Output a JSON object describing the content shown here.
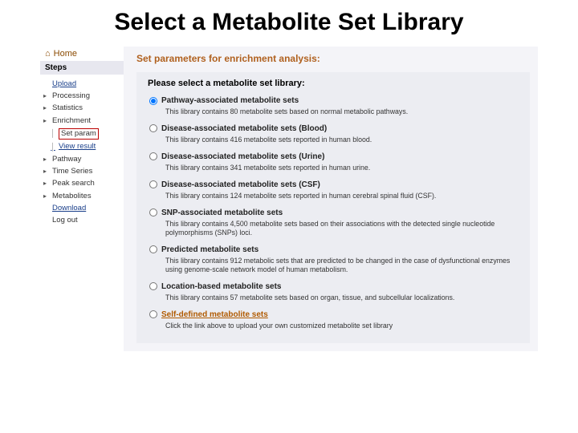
{
  "slide_title": "Select a Metabolite Set Library",
  "home": "Home",
  "steps_header": "Steps",
  "sidebar": {
    "items": [
      {
        "label": "Upload",
        "type": "link",
        "caret": false,
        "sub": false
      },
      {
        "label": "Processing",
        "type": "node",
        "caret": true,
        "sub": false
      },
      {
        "label": "Statistics",
        "type": "node",
        "caret": true,
        "sub": false
      },
      {
        "label": "Enrichment",
        "type": "node",
        "caret": true,
        "sub": false
      },
      {
        "label": "Set param",
        "type": "selected",
        "caret": false,
        "sub": true
      },
      {
        "label": "View result",
        "type": "link",
        "caret": false,
        "sub": true
      },
      {
        "label": "Pathway",
        "type": "node",
        "caret": true,
        "sub": false
      },
      {
        "label": "Time Series",
        "type": "node",
        "caret": true,
        "sub": false
      },
      {
        "label": "Peak search",
        "type": "node",
        "caret": true,
        "sub": false
      },
      {
        "label": "Metabolites",
        "type": "node",
        "caret": true,
        "sub": false
      },
      {
        "label": "Download",
        "type": "link",
        "caret": false,
        "sub": false
      },
      {
        "label": "Log out",
        "type": "text",
        "caret": false,
        "sub": false
      }
    ]
  },
  "main": {
    "header": "Set parameters for enrichment analysis:",
    "panel_title": "Please select a metabolite set library:",
    "options": [
      {
        "label": "Pathway-associated metabolite sets",
        "desc": "This library contains 80 metabolite sets based on normal metabolic pathways.",
        "checked": true,
        "link": false
      },
      {
        "label": "Disease-associated metabolite sets (Blood)",
        "desc": "This library contains 416 metabolite sets reported in human blood.",
        "checked": false,
        "link": false
      },
      {
        "label": "Disease-associated metabolite sets (Urine)",
        "desc": "This library contains 341 metabolite sets reported in human urine.",
        "checked": false,
        "link": false
      },
      {
        "label": "Disease-associated metabolite sets (CSF)",
        "desc": "This library contains 124 metabolite sets reported in human cerebral spinal fluid (CSF).",
        "checked": false,
        "link": false
      },
      {
        "label": "SNP-associated metabolite sets",
        "desc": "This library contains 4,500 metabolite sets based on their associations with the detected single nucleotide polymorphisms (SNPs) loci.",
        "checked": false,
        "link": false
      },
      {
        "label": "Predicted metabolite sets",
        "desc": "This library contains 912 metabolic sets that are predicted to be changed in the case of dysfunctional enzymes using genome-scale network model of human metabolism.",
        "checked": false,
        "link": false
      },
      {
        "label": "Location-based metabolite sets",
        "desc": "This library contains 57 metabolite sets based on organ, tissue, and subcellular localizations.",
        "checked": false,
        "link": false
      },
      {
        "label": "Self-defined metabolite sets",
        "desc": "Click the link above to upload your own customized metabolite set library",
        "checked": false,
        "link": true
      }
    ]
  }
}
